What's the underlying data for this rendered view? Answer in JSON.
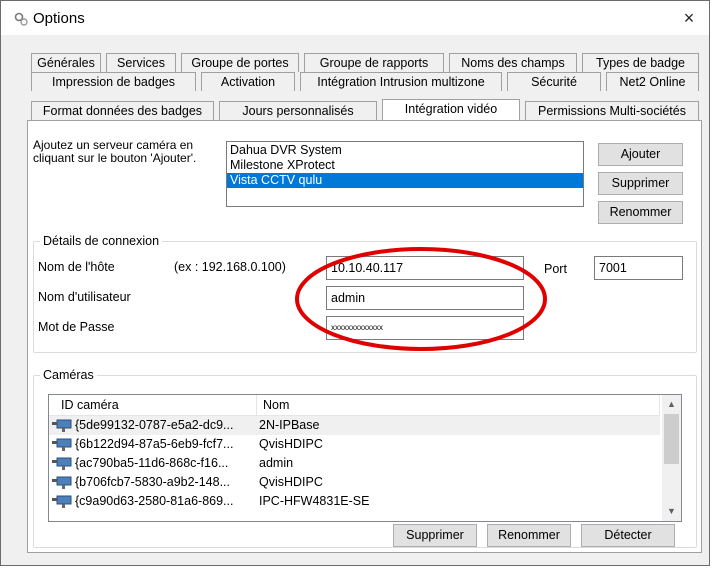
{
  "window": {
    "title": "Options",
    "close_glyph": "×",
    "icon": "options-gear-icon"
  },
  "tabs": {
    "row1": [
      "Générales",
      "Services",
      "Groupe de portes",
      "Groupe de rapports",
      "Noms des champs",
      "Types de badge"
    ],
    "row2": [
      "Impression de badges",
      "Activation",
      "Intégration Intrusion multizone",
      "Sécurité",
      "Net2 Online"
    ],
    "row3": [
      "Format données des badges",
      "Jours personnalisés",
      "Intégration vidéo",
      "Permissions Multi-sociétés"
    ],
    "active": "Intégration vidéo"
  },
  "servers": {
    "intro": "Ajoutez un serveur caméra en cliquant sur le bouton 'Ajouter'.",
    "items": [
      "Dahua DVR System",
      "Milestone XProtect",
      "Vista CCTV qulu"
    ],
    "selected_index": 2,
    "add_label": "Ajouter",
    "delete_label": "Supprimer",
    "rename_label": "Renommer"
  },
  "connection": {
    "legend": "Détails de connexion",
    "host_label": "Nom de l'hôte",
    "host_hint": "(ex : 192.168.0.100)",
    "host_value": "10.10.40.117",
    "port_label": "Port",
    "port_value": "7001",
    "user_label": "Nom d'utilisateur",
    "user_value": "admin",
    "password_label": "Mot de Passe",
    "password_value": "xxxxxxxxxxxxx"
  },
  "cameras": {
    "legend": "Caméras",
    "columns": [
      "ID caméra",
      "Nom"
    ],
    "rows": [
      {
        "id": "{5de99132-0787-e5a2-dc9...",
        "name": "2N-IPBase"
      },
      {
        "id": "{6b122d94-87a5-6eb9-fcf7...",
        "name": "QvisHDIPC"
      },
      {
        "id": "{ac790ba5-11d6-868c-f16...",
        "name": "admin"
      },
      {
        "id": "{b706fcb7-5830-a9b2-148...",
        "name": "QvisHDIPC"
      },
      {
        "id": "{c9a90d63-2580-81a6-869...",
        "name": "IPC-HFW4831E-SE"
      }
    ],
    "delete_label": "Supprimer",
    "rename_label": "Renommer",
    "detect_label": "Détecter"
  },
  "colors": {
    "selection": "#0078d7",
    "annotation": "#e00000"
  }
}
